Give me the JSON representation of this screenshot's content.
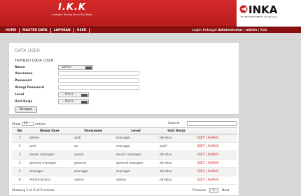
{
  "header": {
    "brand_title": "I.K.K",
    "brand_subtitle": "Indikator Kinerja Kunci Unit Kerja",
    "company_name": "INKA",
    "company_sub": "PT. INDUSTRI KERETA API (Persero)",
    "colors": {
      "red": "#c42323",
      "dark_red": "#8a0f0f"
    }
  },
  "nav": {
    "items": [
      "HOME",
      "MASTER DATA",
      "LAPORAN",
      "USER"
    ],
    "login_prefix": "Login Sebagai",
    "login_user": "Administrator",
    "login_sep": "|",
    "login_admin": "admin",
    "login_suffix": "| Keb"
  },
  "form": {
    "page_title": "DATA USER",
    "section_title": "TAMBAH DATA USER",
    "nama_label": "Nama",
    "nama_value": "admin",
    "username_label": "Username",
    "password_label": "Password",
    "ulangi_label": "Ulangi Password",
    "level_label": "Level",
    "level_value": "-- PILIH --",
    "unit_label": "Unit Kerja",
    "unit_value": "-- PILIH --",
    "save_label": "Simpan"
  },
  "table": {
    "show_prefix": "Show",
    "show_value": "10",
    "show_suffix": "entries",
    "search_label": "Search:",
    "headers": [
      "No",
      "Nama User",
      "Username",
      "Level",
      "Unit Kerja",
      ""
    ],
    "rows": [
      [
        "1",
        "admin",
        "andi",
        "manager",
        "direktur",
        "EDIT | HAPUS"
      ],
      [
        "2",
        "andi",
        "aa",
        "manager",
        "staff",
        "EDIT | HAPUS"
      ],
      [
        "3",
        "senior manager",
        "senior",
        "senior manager",
        "direktur",
        "EDIT | HAPUS"
      ],
      [
        "4",
        "general manager",
        "general",
        "general manager",
        "direktur",
        "EDIT | HAPUS"
      ],
      [
        "5",
        "manager",
        "manager",
        "manager",
        "direktur",
        "EDIT | HAPUS"
      ],
      [
        "6",
        "Administrator",
        "admin",
        "admin",
        "direktur",
        "EDIT | HAPUS"
      ]
    ],
    "info": "Showing 1 to 6 of 6 entries",
    "prev": "Previous",
    "page": "1",
    "next": "Next"
  }
}
